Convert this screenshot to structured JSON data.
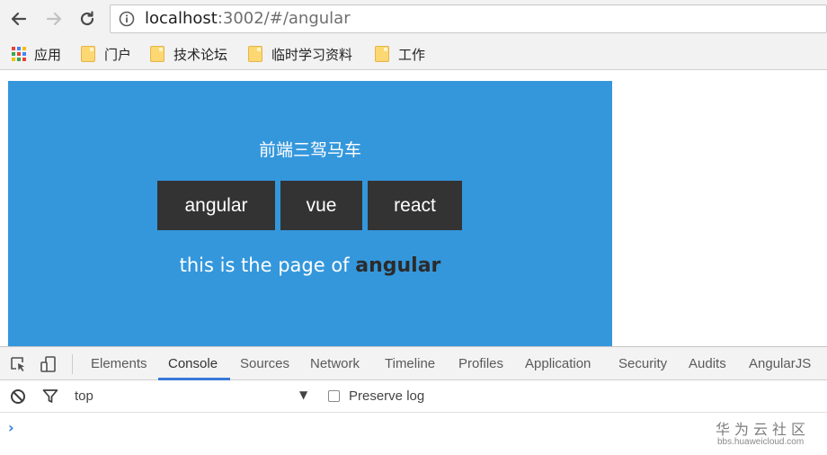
{
  "browser": {
    "url_host": "localhost",
    "url_rest": ":3002/#/angular"
  },
  "bookmarks": [
    {
      "label": "应用",
      "icon": "apps-grid-icon"
    },
    {
      "label": "门户",
      "icon": "folder-icon"
    },
    {
      "label": "技术论坛",
      "icon": "folder-icon"
    },
    {
      "label": "临时学习资料",
      "icon": "folder-icon"
    },
    {
      "label": "工作",
      "icon": "folder-icon"
    }
  ],
  "app": {
    "title": "前端三驾马车",
    "buttons": [
      {
        "label": "angular"
      },
      {
        "label": "vue"
      },
      {
        "label": "react"
      }
    ],
    "page_text_prefix": "this is the page of ",
    "page_text_route": "angular",
    "colors": {
      "panel": "#3497dc",
      "button": "#333333",
      "route_text": "#2b2b2b"
    }
  },
  "devtools": {
    "tabs": [
      "Elements",
      "Console",
      "Sources",
      "Network",
      "Timeline",
      "Profiles",
      "Application",
      "Security",
      "Audits",
      "AngularJS"
    ],
    "active_tab": "Console",
    "context": "top",
    "preserve_log_label": "Preserve log",
    "preserve_log_checked": false,
    "prompt_symbol": "›"
  },
  "watermark": {
    "zh": "华为云社区",
    "en": "bbs.huaweicloud.com"
  }
}
